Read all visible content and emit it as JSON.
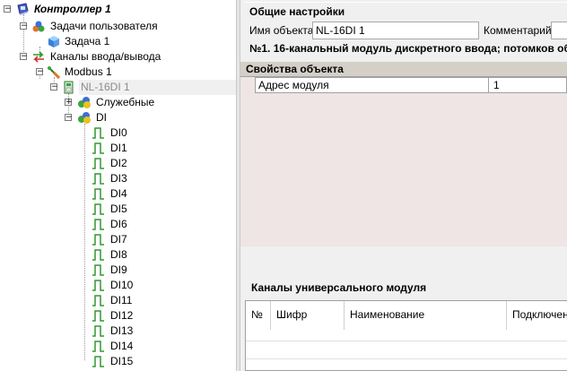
{
  "tree": {
    "items": [
      {
        "label": "Контроллер 1",
        "icon": "controller-icon"
      },
      {
        "label": "Задачи пользователя",
        "icon": "tasks-icon"
      },
      {
        "label": "Задача 1",
        "icon": "task-cube-icon"
      },
      {
        "label": "Каналы ввода/вывода",
        "icon": "io-channels-icon"
      },
      {
        "label": "Modbus 1",
        "icon": "modbus-icon"
      },
      {
        "label": "NL-16DI 1",
        "icon": "module-icon"
      },
      {
        "label": "Служебные",
        "icon": "group-icon"
      },
      {
        "label": "DI",
        "icon": "group-icon"
      }
    ],
    "channels": [
      "DI0",
      "DI1",
      "DI2",
      "DI3",
      "DI4",
      "DI5",
      "DI6",
      "DI7",
      "DI8",
      "DI9",
      "DI10",
      "DI11",
      "DI12",
      "DI13",
      "DI14",
      "DI15"
    ]
  },
  "general": {
    "title": "Общие настройки",
    "name_label": "Имя объекта",
    "name_value": "NL-16DI 1",
    "comment_label": "Комментарий",
    "comment_value": "",
    "info": "№1. 16-канальный модуль дискретного ввода; потомков об"
  },
  "props": {
    "title": "Свойства объекта",
    "rows": [
      {
        "name": "Адрес модуля",
        "value": "1"
      }
    ]
  },
  "channels_table": {
    "title": "Каналы универсального модуля",
    "columns": [
      "№",
      "Шифр",
      "Наименование",
      "Подключен"
    ]
  },
  "colors": {
    "selected_text": "#8a8a8a",
    "props_bg": "#efe5e5",
    "pulse_green": "#2e9a2e"
  }
}
